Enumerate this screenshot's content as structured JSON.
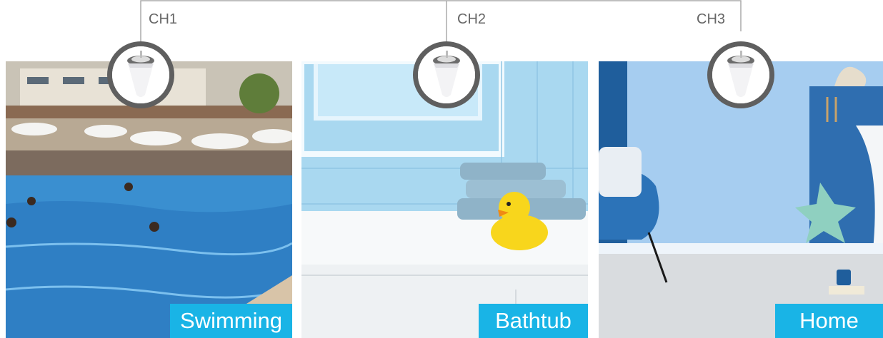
{
  "channels": [
    {
      "label": "CH1",
      "badge": "Swimming",
      "icon": "pool-thermometer-sensor-icon"
    },
    {
      "label": "CH2",
      "badge": "Bathtub",
      "icon": "pool-thermometer-sensor-icon"
    },
    {
      "label": "CH3",
      "badge": "Home",
      "icon": "pool-thermometer-sensor-icon"
    }
  ],
  "colors": {
    "badge": "#19b4e6",
    "connector": "#aaaaaa",
    "sensor_ring": "#5f5f5f"
  }
}
